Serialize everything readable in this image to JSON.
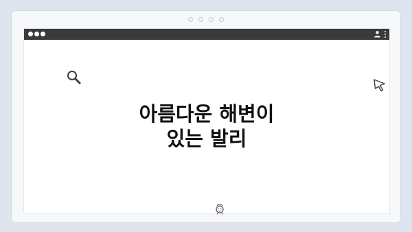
{
  "headline": {
    "line1": "아름다운 해변이",
    "line2": "있는 발리"
  },
  "icons": {
    "search": "search-icon",
    "cursor": "cursor-icon",
    "face": "face-icon",
    "user": "user-icon",
    "menu": "kebab-menu-icon"
  },
  "colors": {
    "background": "#dfe5ee",
    "frame": "#f7f8fa",
    "title_bar": "#3a3a3a",
    "content": "#ffffff",
    "text": "#111111"
  }
}
